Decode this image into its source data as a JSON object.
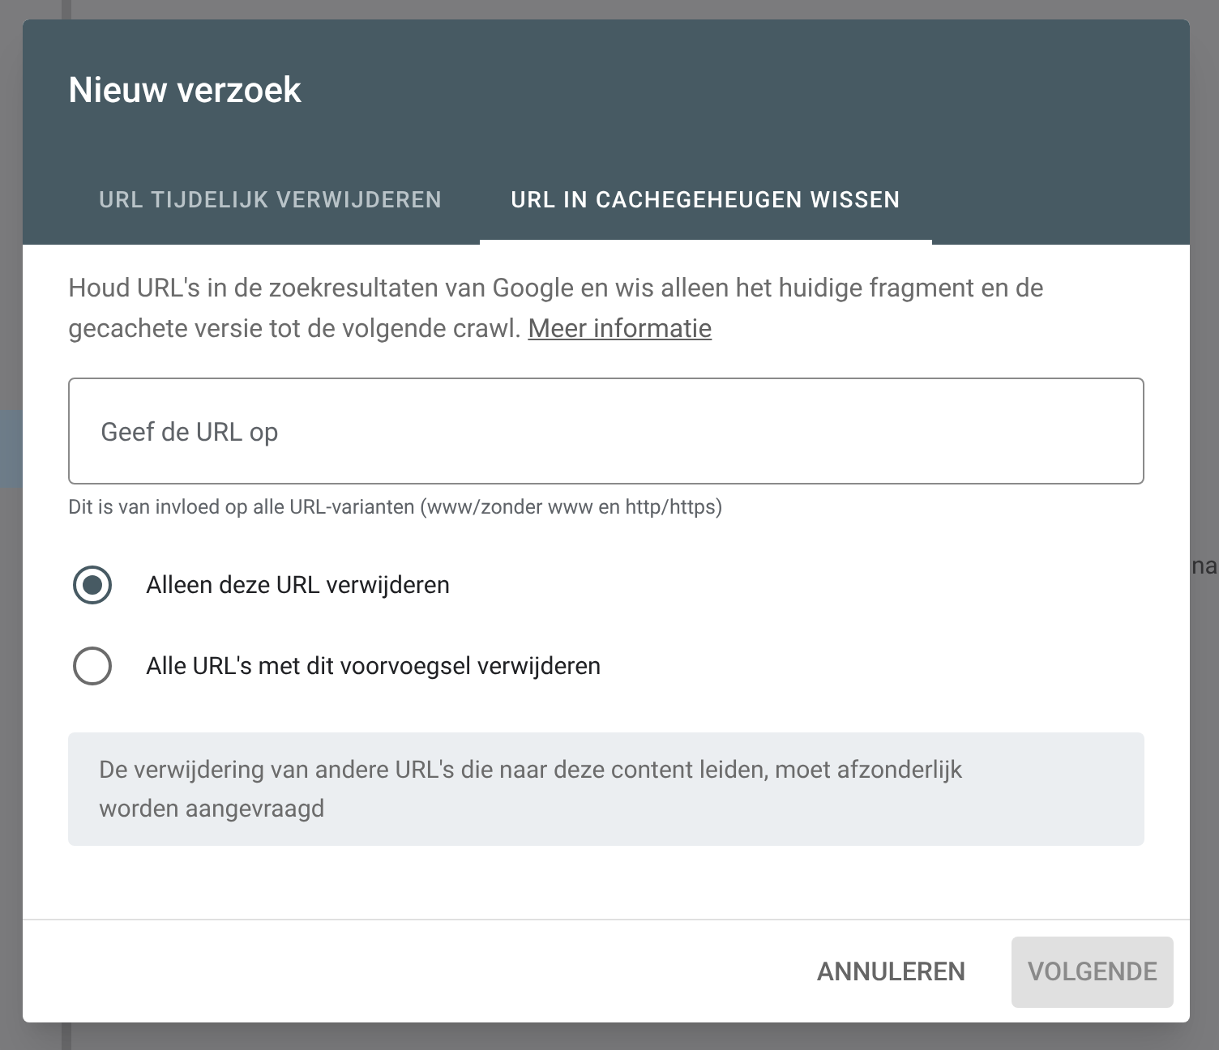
{
  "background": {
    "text": "na"
  },
  "dialog": {
    "title": "Nieuw verzoek",
    "tabs": [
      {
        "label": "URL TIJDELIJK VERWIJDEREN",
        "selected": false
      },
      {
        "label": "URL IN CACHEGEHEUGEN WISSEN",
        "selected": true
      }
    ],
    "description": "Houd URL's in de zoekresultaten van Google en wis alleen het huidige fragment en de gecachete versie tot de volgende crawl.",
    "link": "Meer informatie",
    "url_field": {
      "placeholder": "Geef de URL op",
      "helper": "Dit is van invloed op alle URL-varianten (www/zonder www en http/https)"
    },
    "options": [
      {
        "label": "Alleen deze URL verwijderen",
        "selected": true
      },
      {
        "label": "Alle URL's met dit voorvoegsel verwijderen",
        "selected": false
      }
    ],
    "notice": "De verwijdering van andere URL's die naar deze content leiden, moet afzonderlijk worden aangevraagd",
    "buttons": [
      {
        "label": "ANNULEREN",
        "disabled": false
      },
      {
        "label": "VOLGENDE",
        "disabled": true
      }
    ]
  }
}
